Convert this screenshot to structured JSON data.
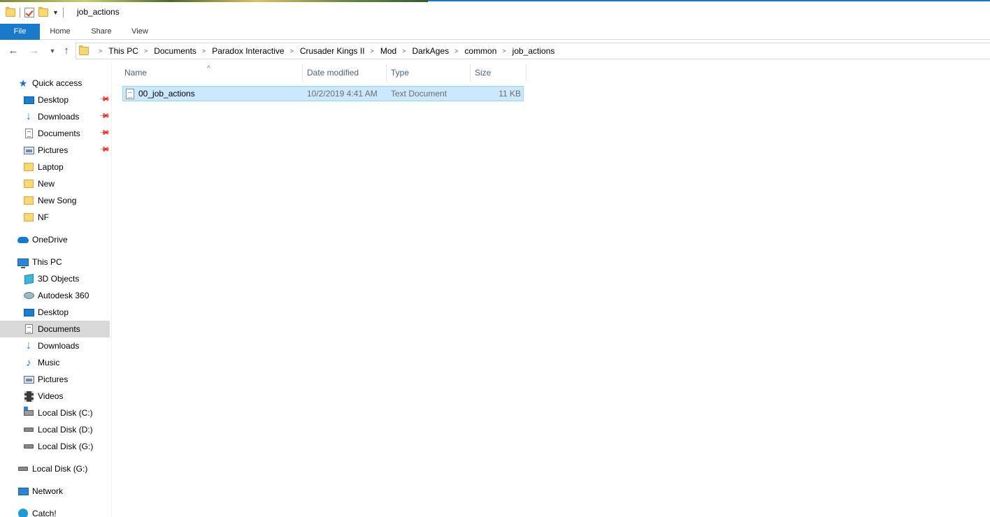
{
  "window": {
    "title": "job_actions"
  },
  "ribbon": {
    "tabs": [
      "File",
      "Home",
      "Share",
      "View"
    ]
  },
  "address": {
    "crumbs": [
      "This PC",
      "Documents",
      "Paradox Interactive",
      "Crusader Kings II",
      "Mod",
      "DarkAges",
      "common",
      "job_actions"
    ]
  },
  "nav": {
    "quick_access": "Quick access",
    "quick_items": [
      "Desktop",
      "Downloads",
      "Documents",
      "Pictures",
      "Laptop",
      "New",
      "New Song",
      "NF"
    ],
    "onedrive": "OneDrive",
    "this_pc": "This PC",
    "pc_items": [
      "3D Objects",
      "Autodesk 360",
      "Desktop",
      "Documents",
      "Downloads",
      "Music",
      "Pictures",
      "Videos",
      "Local Disk (C:)",
      "Local Disk (D:)",
      "Local Disk (G:)"
    ],
    "local_disk_g": "Local Disk (G:)",
    "network": "Network",
    "catch": "Catch!"
  },
  "columns": {
    "name": "Name",
    "date": "Date modified",
    "type": "Type",
    "size": "Size"
  },
  "files": [
    {
      "name": "00_job_actions",
      "date": "10/2/2019 4:41 AM",
      "type": "Text Document",
      "size": "11 KB"
    }
  ],
  "colors": {
    "accent": "#1979ca",
    "selection": "#cce8ff",
    "selection_border": "#99d1ff"
  }
}
